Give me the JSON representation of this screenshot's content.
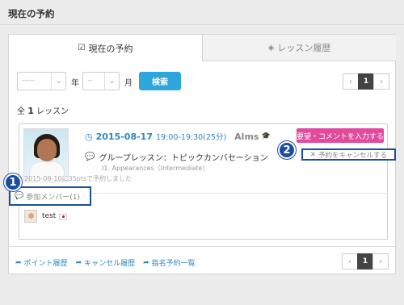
{
  "page": {
    "title": "現在の予約"
  },
  "tabs": [
    {
      "label": "現在の予約",
      "icon": "checkbox-icon"
    },
    {
      "label": "レッスン履歴",
      "icon": "layers-icon"
    }
  ],
  "filter": {
    "year_value": "-----",
    "year_unit": "年",
    "month_value": "--",
    "month_unit": "月",
    "search_label": "検索"
  },
  "pager": {
    "prev": "‹",
    "current": "1",
    "next": "›"
  },
  "summary": {
    "prefix": "全",
    "count": "1",
    "suffix": "レッスン"
  },
  "reservation": {
    "date": "2015-08-17",
    "time": "19:00-19:30(25分)",
    "teacher": "Alms",
    "lesson_type": "グループレッスン：トピックカンバセーション",
    "material": "I1. Appearances（Intermediate）",
    "booked_note": "2015-08-10に35ptsで予約しました",
    "request_button": "要望・コメントを入力する",
    "cancel_link": "予約をキャンセルする",
    "members_label": "参加メンバー(1)",
    "members": [
      {
        "name": "test",
        "flag": "japan-flag-icon"
      }
    ]
  },
  "badges": {
    "one": "1",
    "two": "2"
  },
  "footer": {
    "links": [
      "ポイント履歴",
      "キャンセル履歴",
      "指名予約一覧"
    ]
  },
  "colors": {
    "accent_blue": "#2fa6db",
    "link_blue": "#2f86c4",
    "pink": "#e04b9c",
    "highlight": "#1a4fa0"
  }
}
